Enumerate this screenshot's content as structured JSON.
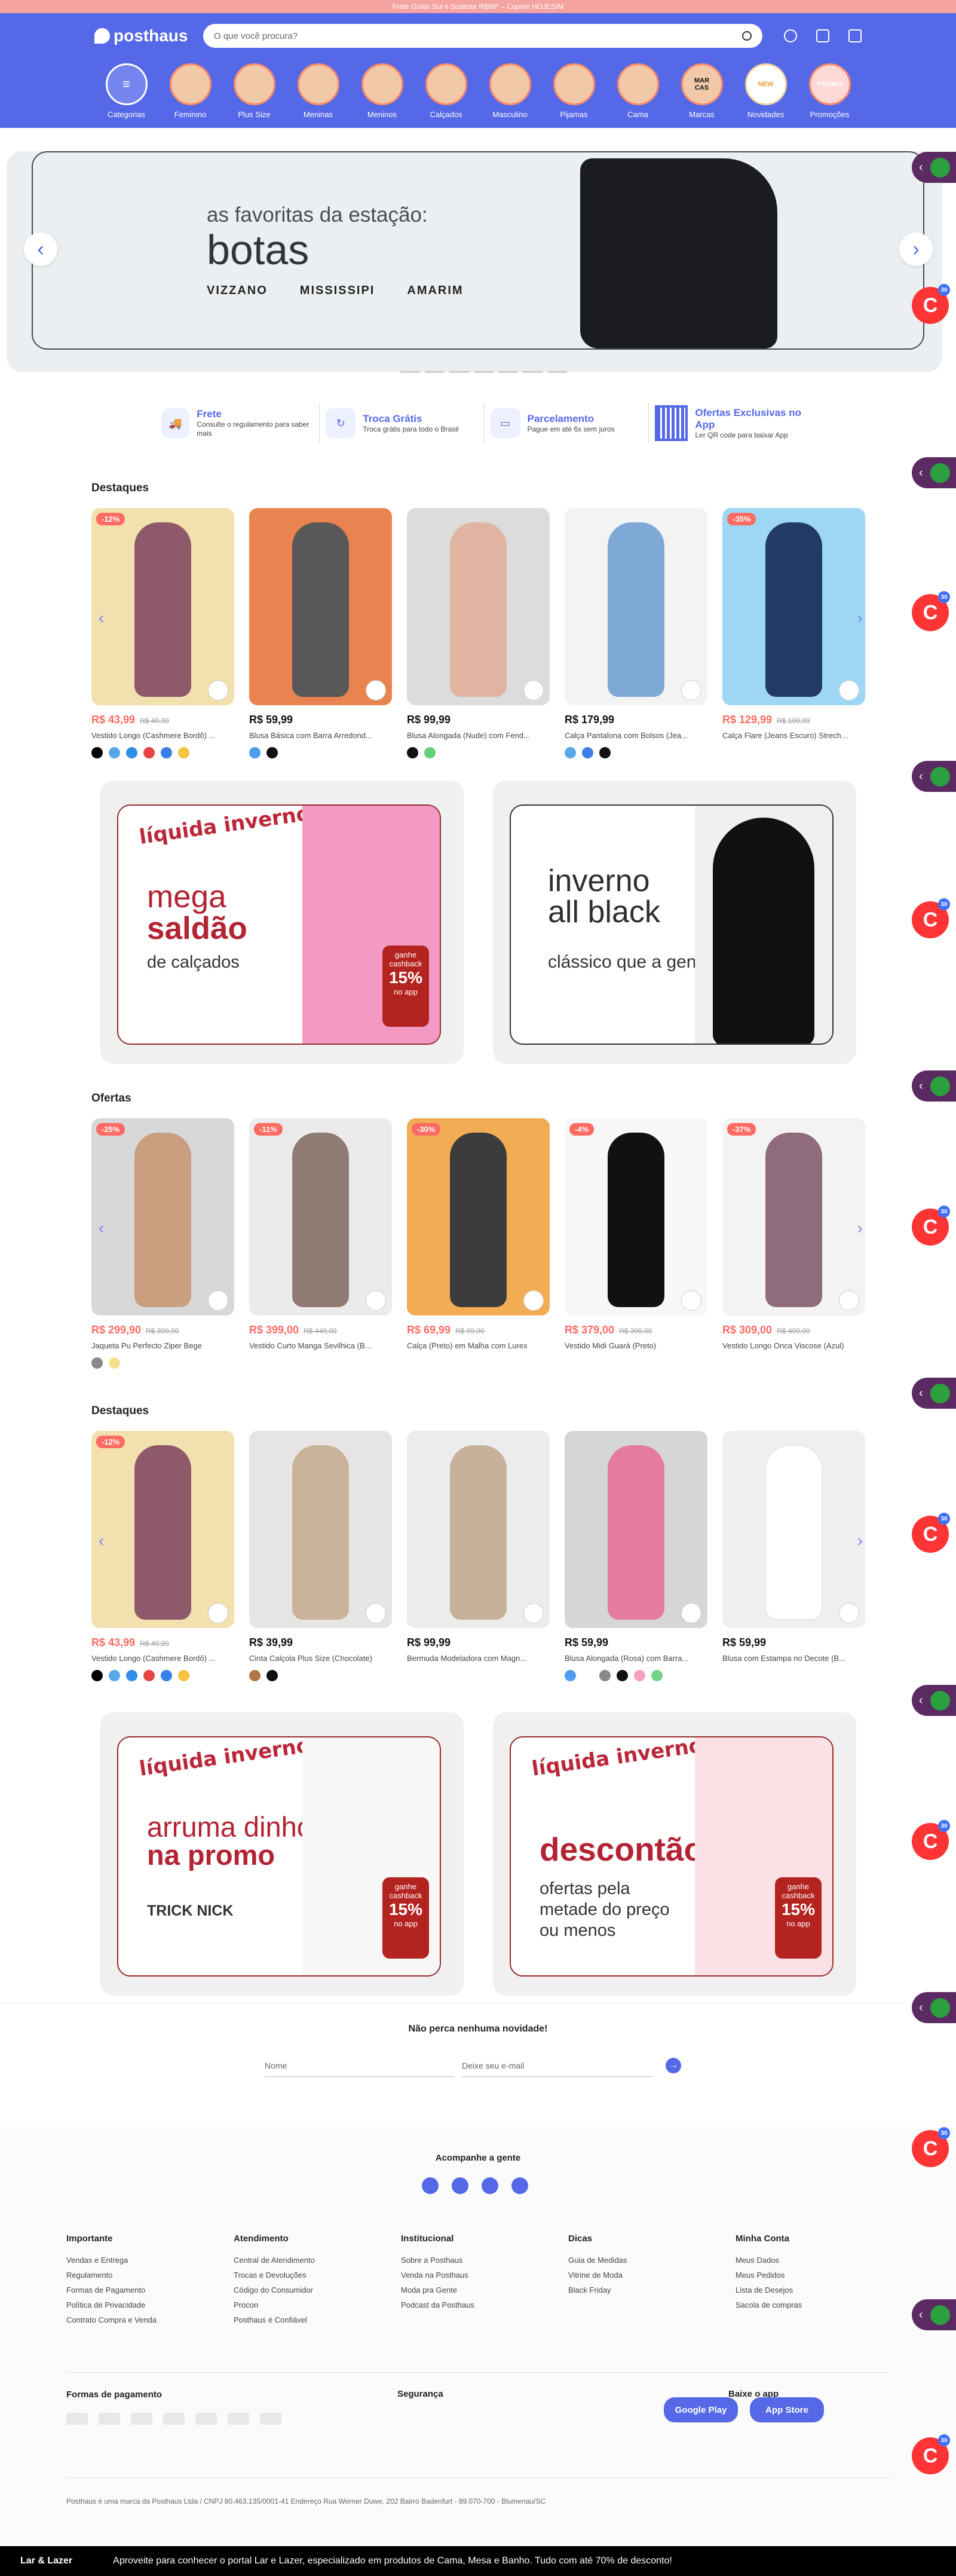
{
  "promo": "Frete Grátis Sul e Sudeste R$99* – Cupom HOJESIM",
  "header": {
    "logo": "posthaus",
    "search": {
      "placeholder": "O que você procura?"
    },
    "categories": [
      "Categorias",
      "Feminino",
      "Plus Size",
      "Meninas",
      "Meninos",
      "Calçados",
      "Masculino",
      "Pijamas",
      "Cama",
      "Marcas",
      "Novidades",
      "Promoções"
    ]
  },
  "hero": {
    "subtitle": "as favoritas da estação:",
    "title": "botas",
    "brands": [
      "VIZZANO",
      "MISSISSIPI",
      "AMARIM"
    ]
  },
  "features": [
    {
      "title": "Frete",
      "sub": "Consulte o regulamento para saber mais"
    },
    {
      "title": "Troca Grátis",
      "sub": "Troca grátis para todo o Brasil"
    },
    {
      "title": "Parcelamento",
      "sub": "Pague em até 6x sem juros"
    },
    {
      "title": "Ofertas Exclusivas no App",
      "sub": "Ler QR code para baixar App"
    }
  ],
  "sections": [
    {
      "title": "Destaques",
      "items": [
        {
          "discount": "-12%",
          "price": "R$ 43,99",
          "old": "R$ 49,99",
          "name": "Vestido Longo (Cashmere Bordô) ...",
          "colors": [
            "#000",
            "#5aa7e8",
            "#2f8ee8",
            "#e94343",
            "#3a7fe7",
            "#f6c341"
          ]
        },
        {
          "discount": "",
          "price": "R$ 59,99",
          "old": "",
          "name": "Blusa Básica com Barra Arredond...",
          "colors": [
            "#4d9cf0",
            "#111"
          ]
        },
        {
          "discount": "",
          "price": "R$ 99,99",
          "old": "",
          "name": "Blusa Alongada (Nude) com Fend...",
          "colors": [
            "#111",
            "#67cf77"
          ]
        },
        {
          "discount": "",
          "price": "R$ 179,99",
          "old": "",
          "name": "Calça Pantalona com Bolsos (Jea...",
          "colors": [
            "#5aa7e8",
            "#3f7fe7",
            "#111"
          ]
        },
        {
          "discount": "-35%",
          "price": "R$ 129,99",
          "old": "R$ 199,99",
          "name": "Calça Flare (Jeans Escuro) Strech...",
          "colors": []
        }
      ]
    },
    {
      "title": "Ofertas",
      "items": [
        {
          "discount": "-25%",
          "price": "R$ 299,90",
          "old": "R$ 399,90",
          "name": "Jaqueta Pu Perfecto Ziper Bege",
          "colors": [
            "#888",
            "#f6e18b"
          ]
        },
        {
          "discount": "-11%",
          "price": "R$ 399,00",
          "old": "R$ 449,00",
          "name": "Vestido Curto Manga Sevilhica (B...",
          "colors": []
        },
        {
          "discount": "-30%",
          "price": "R$ 69,99",
          "old": "R$ 99,90",
          "name": "Calça (Preto) em Malha com Lurex",
          "colors": []
        },
        {
          "discount": "-4%",
          "price": "R$ 379,00",
          "old": "R$ 395,00",
          "name": "Vestido Midi Guará (Preto)",
          "colors": []
        },
        {
          "discount": "-37%",
          "price": "R$ 309,00",
          "old": "R$ 490,00",
          "name": "Vestido Longo Onca Viscose (Azul)",
          "colors": []
        }
      ]
    },
    {
      "title": "Destaques",
      "items": [
        {
          "discount": "-12%",
          "price": "R$ 43,99",
          "old": "R$ 49,99",
          "name": "Vestido Longo (Cashmere Bordô) ...",
          "colors": [
            "#000",
            "#5aa7e8",
            "#2f8ee8",
            "#e94343",
            "#3a7fe7",
            "#f6c341"
          ]
        },
        {
          "discount": "",
          "price": "R$ 39,99",
          "old": "",
          "name": "Cinta Calçola Plus Size (Chocolate)",
          "colors": [
            "#b17743",
            "#111"
          ]
        },
        {
          "discount": "",
          "price": "R$ 99,99",
          "old": "",
          "name": "Bermuda Modeladora com Magn...",
          "colors": []
        },
        {
          "discount": "",
          "price": "R$ 59,99",
          "old": "",
          "name": "Blusa Alongada (Rosa) com Barra...",
          "colors": [
            "#4d9cf0",
            "#fff",
            "#888",
            "#111",
            "#f5a2c2",
            "#71d487"
          ]
        },
        {
          "discount": "",
          "price": "R$ 59,99",
          "old": "",
          "name": "Blusa com Estampa no Decote (B...",
          "colors": []
        }
      ]
    }
  ],
  "banners": [
    {
      "logo": "líquida inverno",
      "line1": "mega",
      "line2": "saldão",
      "line3": "de calçados",
      "cashback": "ganhe cashback",
      "pct": "15%",
      "app": "no app"
    },
    {
      "line1": "inverno",
      "line2": "all black",
      "line3": "clássico que a gente não dispensa"
    },
    {
      "logo": "líquida inverno",
      "line1": "arruma dinho",
      "line2": "na promo",
      "brand": "TRICK NICK",
      "cashback": "ganhe cashback",
      "pct": "15%",
      "app": "no app"
    },
    {
      "logo": "líquida inverno",
      "line1": "descontão",
      "line3": "ofertas pela metade do preço ou menos",
      "cashback": "ganhe cashback",
      "pct": "15%",
      "app": "no app"
    }
  ],
  "newsletter": {
    "title": "Não perca nenhuma novidade!",
    "name": "Nome",
    "email": "Deixe seu e-mail"
  },
  "footer": {
    "follow": "Acompanhe a gente",
    "columns": [
      {
        "title": "Importante",
        "links": [
          "Vendas e Entrega",
          "Regulamento",
          "Formas de Pagamento",
          "Política de Privacidade",
          "Contrato Compra e Venda"
        ]
      },
      {
        "title": "Atendimento",
        "links": [
          "Central de Atendimento",
          "Trocas e Devoluções",
          "Código do Consumidor",
          "Procon",
          "Posthaus é Confiável"
        ]
      },
      {
        "title": "Institucional",
        "links": [
          "Sobre a Posthaus",
          "Venda na Posthaus",
          "Moda pra Gente",
          "Podcast da Posthaus"
        ]
      },
      {
        "title": "Dicas",
        "links": [
          "Guia de Medidas",
          "Vitrine de Moda",
          "Black Friday"
        ]
      },
      {
        "title": "Minha Conta",
        "links": [
          "Meus Dados",
          "Meus Pedidos",
          "Lista de Desejos",
          "Sacola de compras"
        ]
      }
    ],
    "payments": "Formas de pagamento",
    "security": "Segurança",
    "app": "Baixe o app",
    "stores": [
      "Google Play",
      "App Store"
    ],
    "company": "Posthaus é uma marca da Posthaus Ltda / CNPJ 80.463.135/0001-41 Endereço Rua Werner Duwe, 202 Bairro Badenfurt - 89.070-700 - Blumenau/SC"
  },
  "bottom": {
    "brand": "Lar & Lazer",
    "text": "Aproveite para conhecer o portal Lar e Lazer, especializado em produtos de Cama, Mesa e Banho. Tudo com até 70% de desconto!"
  }
}
